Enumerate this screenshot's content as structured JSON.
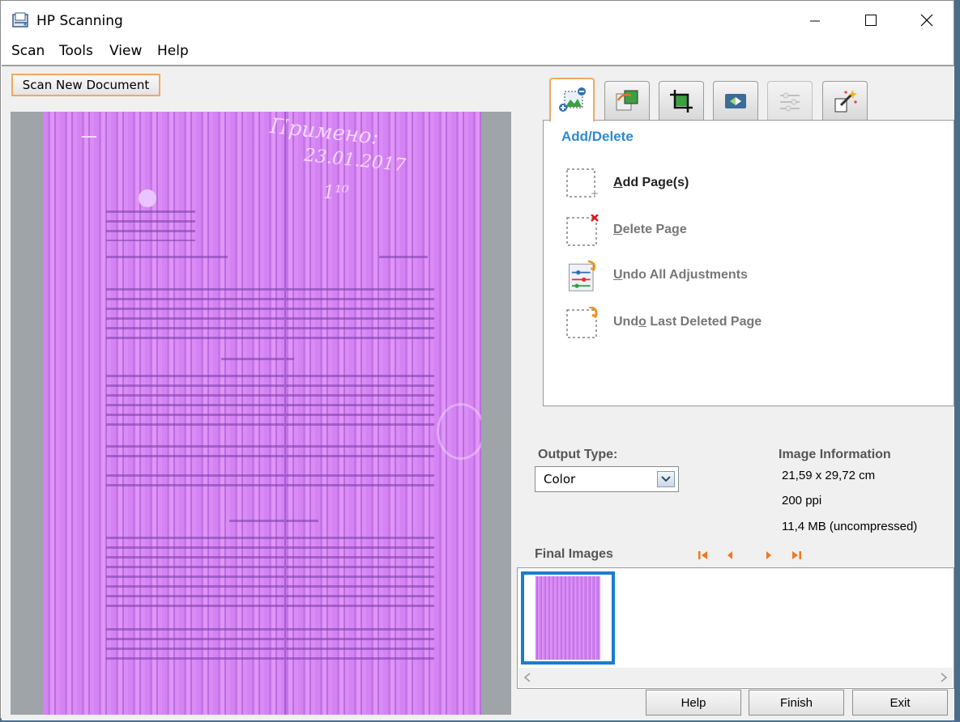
{
  "window": {
    "title": "HP Scanning"
  },
  "menu": [
    "Scan",
    "Tools",
    "View",
    "Help"
  ],
  "toolbar": {
    "scan_new_document": "Scan New Document"
  },
  "scan_preview": {
    "handwriting": [
      "Примено:",
      "23.01.2017",
      "1¹⁰"
    ]
  },
  "tabs": [
    {
      "icon": "add-delete-pages-icon"
    },
    {
      "icon": "image-adjust-icon"
    },
    {
      "icon": "crop-icon"
    },
    {
      "icon": "rotate-icon"
    },
    {
      "icon": "sliders-icon"
    },
    {
      "icon": "magic-wand-icon"
    }
  ],
  "panel": {
    "title": "Add/Delete",
    "actions": [
      {
        "label": "Add Page(s)",
        "mnemonic": "A",
        "rest": "dd Page(s)",
        "enabled": true,
        "icon": "add-page-icon"
      },
      {
        "label": "Delete Page",
        "mnemonic": "D",
        "rest": "elete Page",
        "enabled": false,
        "icon": "delete-page-icon"
      },
      {
        "label": "Undo All Adjustments",
        "mnemonic": "U",
        "rest": "ndo All Adjustments",
        "enabled": false,
        "icon": "undo-adjustments-icon"
      },
      {
        "label": "Undo Last Deleted Page",
        "pre": "Und",
        "mnemonic": "o",
        "rest": " Last Deleted Page",
        "enabled": false,
        "icon": "undo-deleted-page-icon"
      }
    ]
  },
  "output": {
    "label": "Output Type:",
    "value": "Color"
  },
  "image_info": {
    "title": "Image Information",
    "size": "21,59 x 29,72 cm",
    "resolution": "200 ppi",
    "filesize": "11,4 MB (uncompressed)"
  },
  "final_images": {
    "title": "Final Images"
  },
  "buttons": {
    "help": "Help",
    "finish": "Finish",
    "exit": "Exit"
  },
  "colors": {
    "accent": "#2e8ad0",
    "selection": "#1c7ccc",
    "focus": "#f0a860",
    "scan_tint": "#d583f2"
  }
}
